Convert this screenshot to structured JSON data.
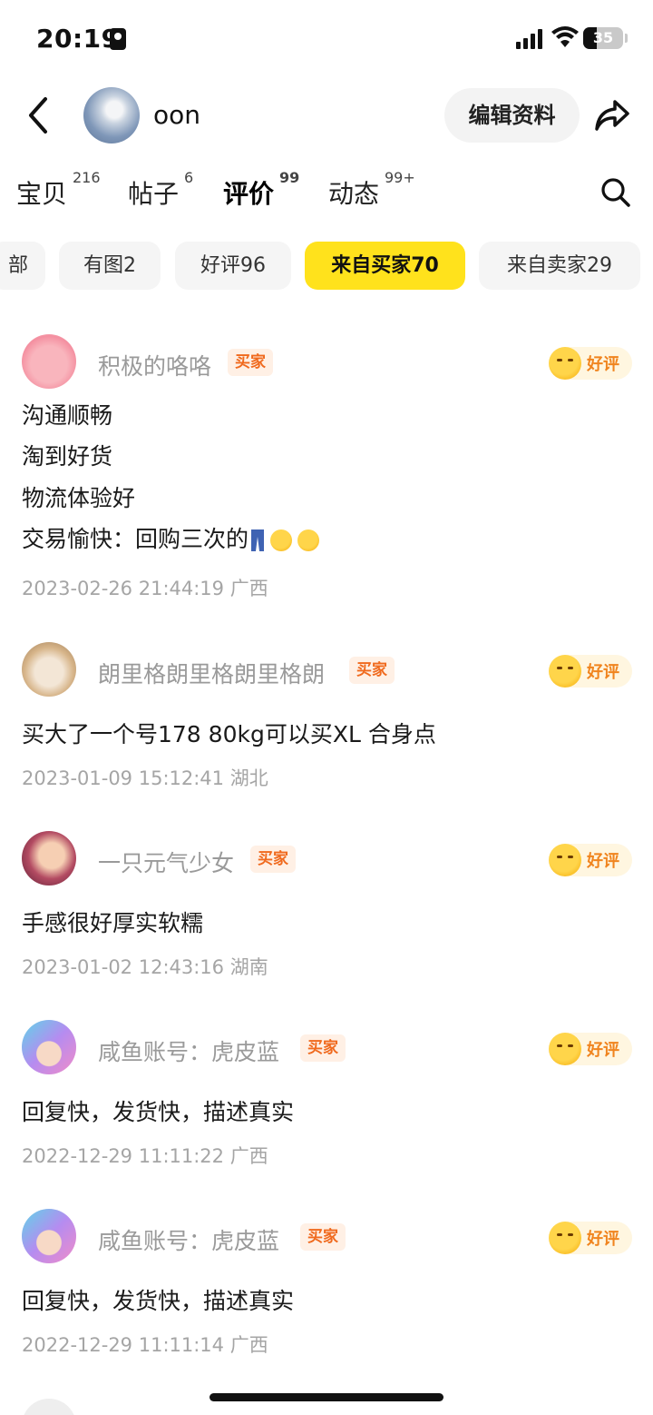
{
  "status_bar": {
    "time": "20:19",
    "battery": "35",
    "battery_level": 0.35
  },
  "header": {
    "username": "oon",
    "edit_label": "编辑资料"
  },
  "tabs": [
    {
      "label": "宝贝",
      "count": "216"
    },
    {
      "label": "帖子",
      "count": "6"
    },
    {
      "label": "评价",
      "count": "99",
      "active": true
    },
    {
      "label": "动态",
      "count": "99+"
    }
  ],
  "filters": [
    "部",
    "有图2",
    "好评96",
    "来自买家70",
    "来自卖家29"
  ],
  "active_filter": "来自买家70",
  "reviews": [
    {
      "name": "积极的咯咯",
      "badge": "买家",
      "rating": "好评",
      "lines": [
        "沟通顺畅",
        "淘到好货",
        "物流体验好",
        "交易愉快：回购三次的"
      ],
      "meta": "2023-02-26 21:44:19 广西"
    },
    {
      "name": "朗里格朗里格朗里格朗",
      "badge": "买家",
      "rating": "好评",
      "lines": [
        "买大了一个号178 80kg可以买XL 合身点"
      ],
      "meta": "2023-01-09 15:12:41 湖北"
    },
    {
      "name": "一只元气少女",
      "badge": "买家",
      "rating": "好评",
      "lines": [
        "手感很好厚实软糯"
      ],
      "meta": "2023-01-02 12:43:16 湖南"
    },
    {
      "name": "咸鱼账号：虎皮蓝",
      "badge": "买家",
      "rating": "好评",
      "lines": [
        "回复快，发货快，描述真实"
      ],
      "meta": "2022-12-29 11:11:22 广西"
    },
    {
      "name": "咸鱼账号：虎皮蓝",
      "badge": "买家",
      "rating": "好评",
      "lines": [
        "回复快，发货快，描述真实"
      ],
      "meta": "2022-12-29 11:11:14 广西"
    }
  ],
  "colors": {
    "accent": "#ffe21c",
    "badge_text": "#f06a1e",
    "badge_bg": "#fff0e5",
    "rating_text": "#f0841e"
  }
}
